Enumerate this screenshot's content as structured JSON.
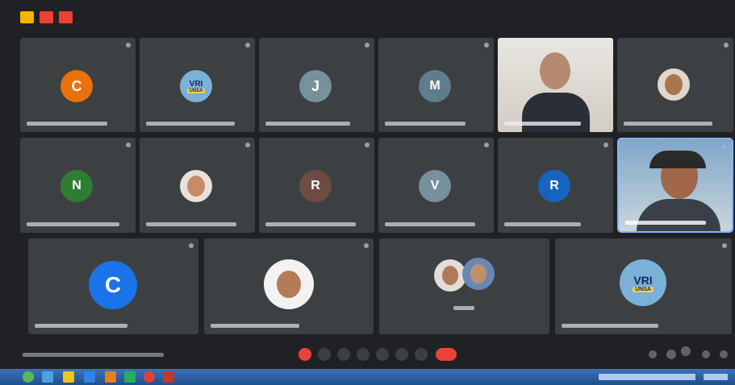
{
  "window": {
    "buttons": [
      {
        "icon": "minimize-icon",
        "color": "#f4b400"
      },
      {
        "icon": "restore-icon",
        "color": "#e94235"
      },
      {
        "icon": "close-icon",
        "color": "#e94235"
      }
    ]
  },
  "participants": [
    {
      "initial": "C",
      "avatar_color": "#e8710a"
    },
    {
      "logo_text": "VRI",
      "logo_sub": "UNSA"
    },
    {
      "initial": "J",
      "avatar_color": "#78909c"
    },
    {
      "initial": "M",
      "avatar_color": "#607d8b"
    },
    {
      "video": true
    },
    {
      "photo": true
    },
    {
      "initial": "N",
      "avatar_color": "#2e7d32"
    },
    {
      "photo": true
    },
    {
      "initial": "R",
      "avatar_color": "#6d4c41"
    },
    {
      "initial": "V",
      "avatar_color": "#78909c"
    },
    {
      "initial": "R",
      "avatar_color": "#1565c0"
    },
    {
      "video": true,
      "speaking": true
    },
    {
      "initial": "C",
      "avatar_color": "#1a73e8"
    },
    {
      "photo": true
    },
    {
      "photo": true,
      "group": true
    },
    {
      "logo_text": "VRI",
      "logo_sub": "UNSA"
    }
  ],
  "controls": {
    "end_call_color": "#ea4335"
  },
  "colors": {
    "background": "#202124",
    "tile": "#3c4043",
    "active_outline": "#8ab4f8",
    "taskbar": "#1f4f8d"
  }
}
